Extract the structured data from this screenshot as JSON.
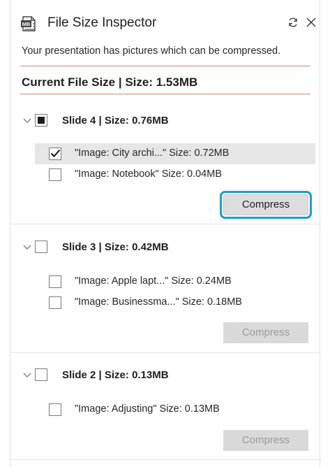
{
  "header": {
    "app_icon": "mb-file-icon",
    "title": "File Size Inspector",
    "refresh_icon": "refresh-icon",
    "close_icon": "close-icon"
  },
  "subtitle": "Your presentation has pictures which can be compressed.",
  "current_size": "Current File Size | Size: 1.53MB",
  "colors": {
    "accent_rule": "#c9897a",
    "focus_ring": "#1aa0c7"
  },
  "slides": [
    {
      "title": "Slide 4 | Size: 0.76MB",
      "checkbox_state": "partial",
      "images": [
        {
          "label": "\"Image: City archi...\" Size: 0.72MB",
          "checked": true
        },
        {
          "label": "\"Image: Notebook\" Size: 0.04MB",
          "checked": false
        }
      ],
      "button": {
        "label": "Compress",
        "enabled": true
      }
    },
    {
      "title": "Slide 3 | Size: 0.42MB",
      "checkbox_state": "unchecked",
      "images": [
        {
          "label": "\"Image: Apple lapt...\" Size: 0.24MB",
          "checked": false
        },
        {
          "label": "\"Image: Businessma...\" Size: 0.18MB",
          "checked": false
        }
      ],
      "button": {
        "label": "Compress",
        "enabled": false
      }
    },
    {
      "title": "Slide 2 | Size: 0.13MB",
      "checkbox_state": "unchecked",
      "images": [
        {
          "label": "\"Image: Adjusting\" Size: 0.13MB",
          "checked": false
        }
      ],
      "button": {
        "label": "Compress",
        "enabled": false
      }
    }
  ]
}
